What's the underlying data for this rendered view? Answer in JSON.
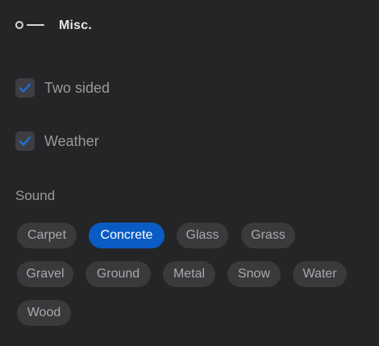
{
  "header": {
    "title": "Misc.",
    "icon": "toggle-switch-icon"
  },
  "options": [
    {
      "label": "Two sided",
      "checked": true
    },
    {
      "label": "Weather",
      "checked": true
    }
  ],
  "sound": {
    "label": "Sound",
    "selected": "Concrete",
    "chips": [
      "Carpet",
      "Concrete",
      "Glass",
      "Grass",
      "Gravel",
      "Ground",
      "Metal",
      "Snow",
      "Water",
      "Wood"
    ]
  },
  "colors": {
    "background": "#252527",
    "chip": "#3a3a3d",
    "accent": "#0a5cc4",
    "checkmark": "#1f6fd6"
  }
}
